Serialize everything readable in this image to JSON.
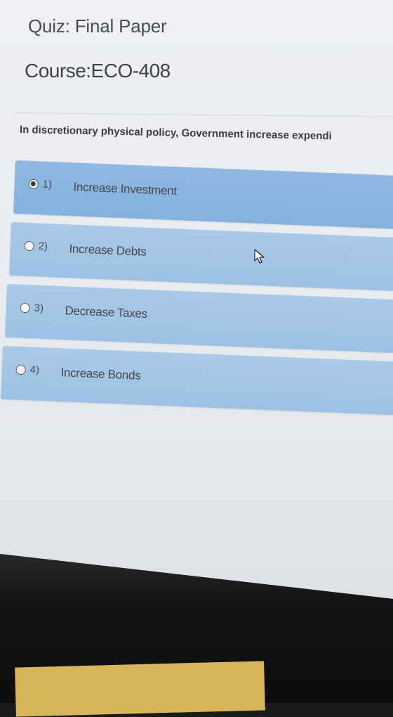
{
  "quiz": {
    "title": "Quiz: Final Paper",
    "course": "Course:ECO-408"
  },
  "question": {
    "text": "In discretionary physical policy, Government increase expendi"
  },
  "options": [
    {
      "number": "1)",
      "label": "Increase Investment",
      "selected": true
    },
    {
      "number": "2)",
      "label": "Increase Debts",
      "selected": false
    },
    {
      "number": "3)",
      "label": "Decrease Taxes",
      "selected": false
    },
    {
      "number": "4)",
      "label": "Increase Bonds",
      "selected": false
    }
  ],
  "colors": {
    "option_bg": "#a9c9e8",
    "option_selected_bg": "#8fb8e2",
    "page_bg": "#eef0f3"
  }
}
